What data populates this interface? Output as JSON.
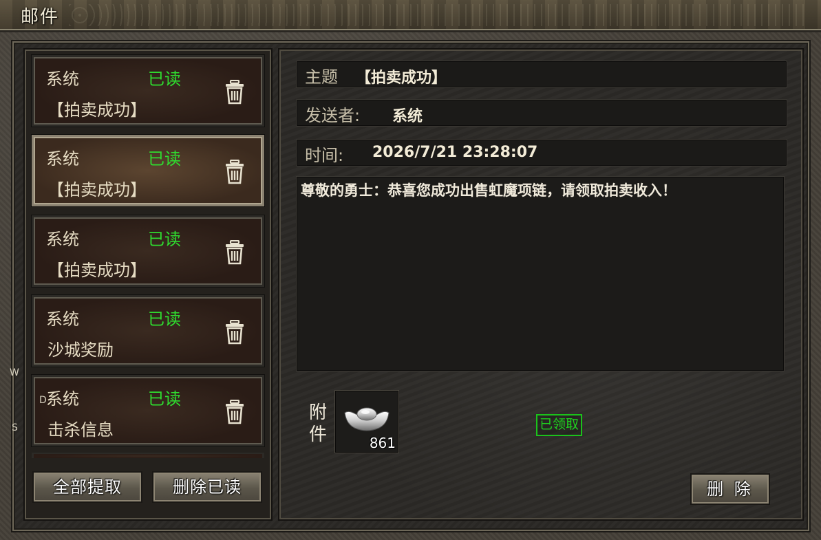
{
  "window": {
    "title": "邮件"
  },
  "mail_list": [
    {
      "sender": "系统",
      "status": "已读",
      "subject": "【拍卖成功】",
      "selected": false
    },
    {
      "sender": "系统",
      "status": "已读",
      "subject": "【拍卖成功】",
      "selected": true
    },
    {
      "sender": "系统",
      "status": "已读",
      "subject": "【拍卖成功】",
      "selected": false
    },
    {
      "sender": "系统",
      "status": "已读",
      "subject": "沙城奖励",
      "selected": false
    },
    {
      "sender": "系统",
      "status": "已读",
      "subject": "击杀信息",
      "selected": false
    }
  ],
  "buttons": {
    "claim_all": "全部提取",
    "delete_read": "删除已读",
    "delete": "删 除"
  },
  "detail": {
    "subject_label": "主题",
    "subject_value": "【拍卖成功】",
    "sender_label": "发送者:",
    "sender_value": "系统",
    "time_label": "时间:",
    "time_value": "2026/7/21 23:28:07",
    "body": "尊敬的勇士：恭喜您成功出售虹魔项链，请领取拍卖收入！",
    "attachment_label": "附件",
    "attachment": {
      "icon": "silver-ingot-icon",
      "count": "861"
    },
    "claimed_badge": "已领取"
  },
  "edge_letters": [
    "W",
    "D",
    "S"
  ],
  "colors": {
    "status_green": "#2fdc2f",
    "text_light": "#e6dcc3",
    "claimed_green": "#1fd21f"
  }
}
